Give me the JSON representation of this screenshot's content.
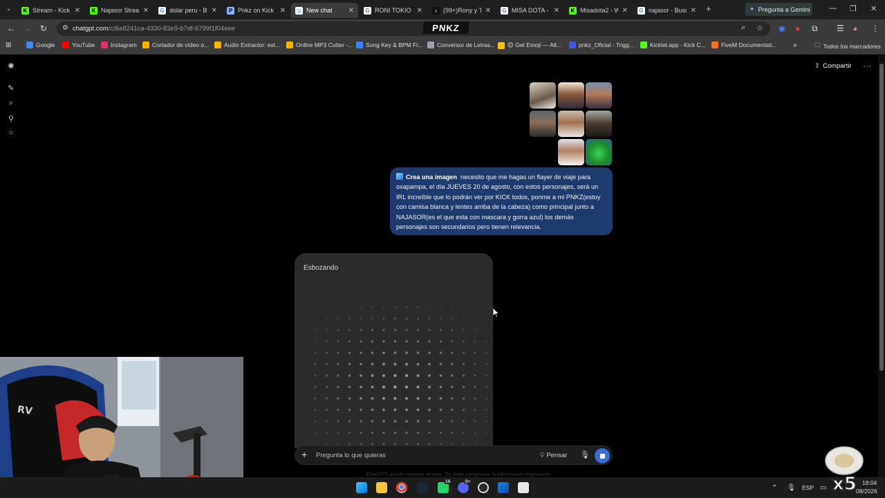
{
  "browser": {
    "tabs": [
      {
        "label": "Stream - Kick",
        "fav_color": "#53fc18",
        "fav_text": "K"
      },
      {
        "label": "Najasor Stream",
        "fav_color": "#53fc18",
        "fav_text": "K"
      },
      {
        "label": "dolar peru - B",
        "fav_color": "#ffffff",
        "fav_text": "G"
      },
      {
        "label": "Pnkz on Kick",
        "fav_color": "#8ab4f8",
        "fav_text": "P"
      },
      {
        "label": "New chat",
        "fav_color": "#ffffff",
        "fav_text": "◎",
        "active": true
      },
      {
        "label": "RONI TOKIO -",
        "fav_color": "#ffffff",
        "fav_text": "G"
      },
      {
        "label": "(99+)Rony y T",
        "fav_color": "#111111",
        "fav_text": "♪"
      },
      {
        "label": "MISA DOTA -",
        "fav_color": "#ffffff",
        "fav_text": "G"
      },
      {
        "label": "Misadota2 - W",
        "fav_color": "#53fc18",
        "fav_text": "K"
      },
      {
        "label": "najasor - Busc",
        "fav_color": "#ffffff",
        "fav_text": "G"
      }
    ],
    "new_tab": "+",
    "gemini_button": "Pregunta a Gemini",
    "url_host": "chatgpt.com",
    "url_path": "/c/6a8241ca-4330-83e9-b7df-6799f1f04eee",
    "page_overlay_logo": "PNKZ",
    "bookmarks": [
      {
        "label": "Google",
        "color": "#4285f4"
      },
      {
        "label": "YouTube",
        "color": "#ff0000"
      },
      {
        "label": "Instagram",
        "color": "#e1306c"
      },
      {
        "label": "Cortador de vídeo o...",
        "color": "#ffb300"
      },
      {
        "label": "Audio Extractor: ext...",
        "color": "#ffb300"
      },
      {
        "label": "Online MP3 Cutter -...",
        "color": "#ffb300"
      },
      {
        "label": "Song Key & BPM Fi...",
        "color": "#3b82f6"
      },
      {
        "label": "Conversor de Letras...",
        "color": "#9ca3af"
      },
      {
        "label": "😊 Get Emoji — All...",
        "color": "#f5c518"
      },
      {
        "label": "pnkz_Oficial - Trigg...",
        "color": "#3b5bdb"
      },
      {
        "label": "Kicklet.app - Kick C...",
        "color": "#53fc18"
      },
      {
        "label": "FiveM Documentati...",
        "color": "#f97316"
      }
    ],
    "bookmarks_overflow": "»",
    "all_bookmarks": "Todos los marcadores"
  },
  "chat": {
    "share_label": "Compartir",
    "more_label": "···",
    "user_message": {
      "tool_label": "Crea una imagen",
      "text": "necesito que me hagas un flayer de viaje para oxapampa, el día JUEVES 20 de agosto, con estos personajes, será un IRL increíble que lo podrán ver por KICK todos, ponme a mi PNKZ(estoy con camisa blanca y lentes arriba de la cabeza) como principal junto a NAJASOR(es el que esta con mascara y gorra azul) los demás personajes son secundarios pero tienen relevancia."
    },
    "generation_status": "Esbozando",
    "composer": {
      "placeholder": "Pregunta lo que quieras",
      "think_label": "Pensar"
    },
    "disclaimer": "ChatGPT puede cometer errores. Se debe comprobar la información importante."
  },
  "taskbar": {
    "lang": "ESP",
    "time": "18:04",
    "date": "08/2026",
    "whatsapp_badge": "16",
    "discord_badge": "9+"
  },
  "overlay": {
    "badge_text": "x5"
  }
}
